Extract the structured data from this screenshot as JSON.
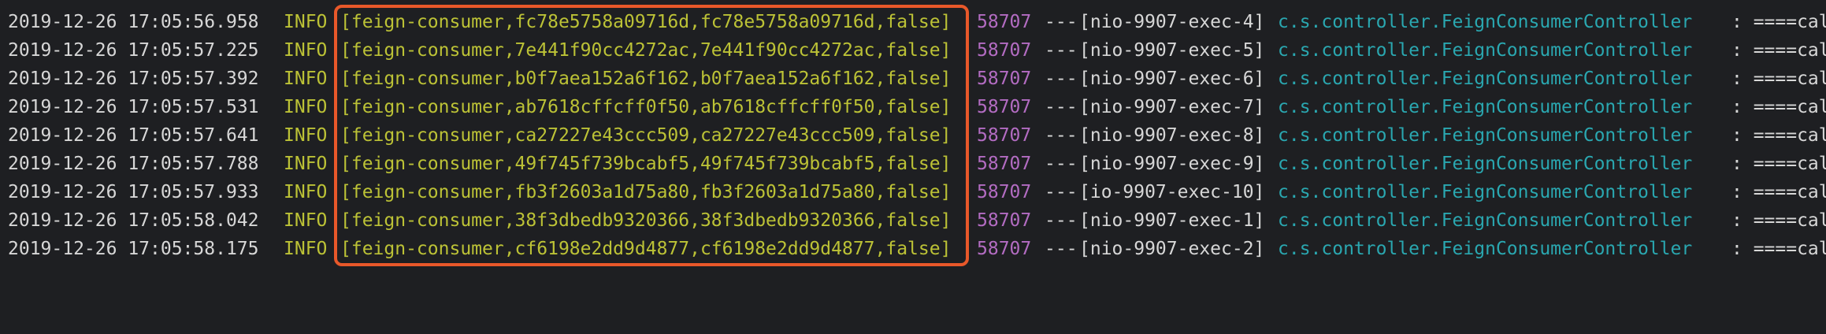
{
  "colors": {
    "background": "#1e1f22",
    "timestamp": "#d7d7d7",
    "level": "#bcc236",
    "trace": "#bcc236",
    "pid": "#b36cc2",
    "logger": "#2aa7b0",
    "highlight": "#e8582a"
  },
  "log": {
    "lines": [
      {
        "timestamp": "2019-12-26 17:05:56.958",
        "level": "INFO",
        "trace": "[feign-consumer,fc78e5758a09716d,fc78e5758a09716d,false]",
        "pid": "58707",
        "separator": "---",
        "thread": "[nio-9907-exec-4]",
        "logger": "c.s.controller.FeignConsumerController",
        "message": ": ====cal"
      },
      {
        "timestamp": "2019-12-26 17:05:57.225",
        "level": "INFO",
        "trace": "[feign-consumer,7e441f90cc4272ac,7e441f90cc4272ac,false]",
        "pid": "58707",
        "separator": "---",
        "thread": "[nio-9907-exec-5]",
        "logger": "c.s.controller.FeignConsumerController",
        "message": ": ====cal"
      },
      {
        "timestamp": "2019-12-26 17:05:57.392",
        "level": "INFO",
        "trace": "[feign-consumer,b0f7aea152a6f162,b0f7aea152a6f162,false]",
        "pid": "58707",
        "separator": "---",
        "thread": "[nio-9907-exec-6]",
        "logger": "c.s.controller.FeignConsumerController",
        "message": ": ====cal"
      },
      {
        "timestamp": "2019-12-26 17:05:57.531",
        "level": "INFO",
        "trace": "[feign-consumer,ab7618cffcff0f50,ab7618cffcff0f50,false]",
        "pid": "58707",
        "separator": "---",
        "thread": "[nio-9907-exec-7]",
        "logger": "c.s.controller.FeignConsumerController",
        "message": ": ====cal"
      },
      {
        "timestamp": "2019-12-26 17:05:57.641",
        "level": "INFO",
        "trace": "[feign-consumer,ca27227e43ccc509,ca27227e43ccc509,false]",
        "pid": "58707",
        "separator": "---",
        "thread": "[nio-9907-exec-8]",
        "logger": "c.s.controller.FeignConsumerController",
        "message": ": ====cal"
      },
      {
        "timestamp": "2019-12-26 17:05:57.788",
        "level": "INFO",
        "trace": "[feign-consumer,49f745f739bcabf5,49f745f739bcabf5,false]",
        "pid": "58707",
        "separator": "---",
        "thread": "[nio-9907-exec-9]",
        "logger": "c.s.controller.FeignConsumerController",
        "message": ": ====cal"
      },
      {
        "timestamp": "2019-12-26 17:05:57.933",
        "level": "INFO",
        "trace": "[feign-consumer,fb3f2603a1d75a80,fb3f2603a1d75a80,false]",
        "pid": "58707",
        "separator": "---",
        "thread": "[io-9907-exec-10]",
        "logger": "c.s.controller.FeignConsumerController",
        "message": ": ====cal"
      },
      {
        "timestamp": "2019-12-26 17:05:58.042",
        "level": "INFO",
        "trace": "[feign-consumer,38f3dbedb9320366,38f3dbedb9320366,false]",
        "pid": "58707",
        "separator": "---",
        "thread": "[nio-9907-exec-1]",
        "logger": "c.s.controller.FeignConsumerController",
        "message": ": ====cal"
      },
      {
        "timestamp": "2019-12-26 17:05:58.175",
        "level": "INFO",
        "trace": "[feign-consumer,cf6198e2dd9d4877,cf6198e2dd9d4877,false]",
        "pid": "58707",
        "separator": "---",
        "thread": "[nio-9907-exec-2]",
        "logger": "c.s.controller.FeignConsumerController",
        "message": ": ====cal"
      }
    ]
  }
}
